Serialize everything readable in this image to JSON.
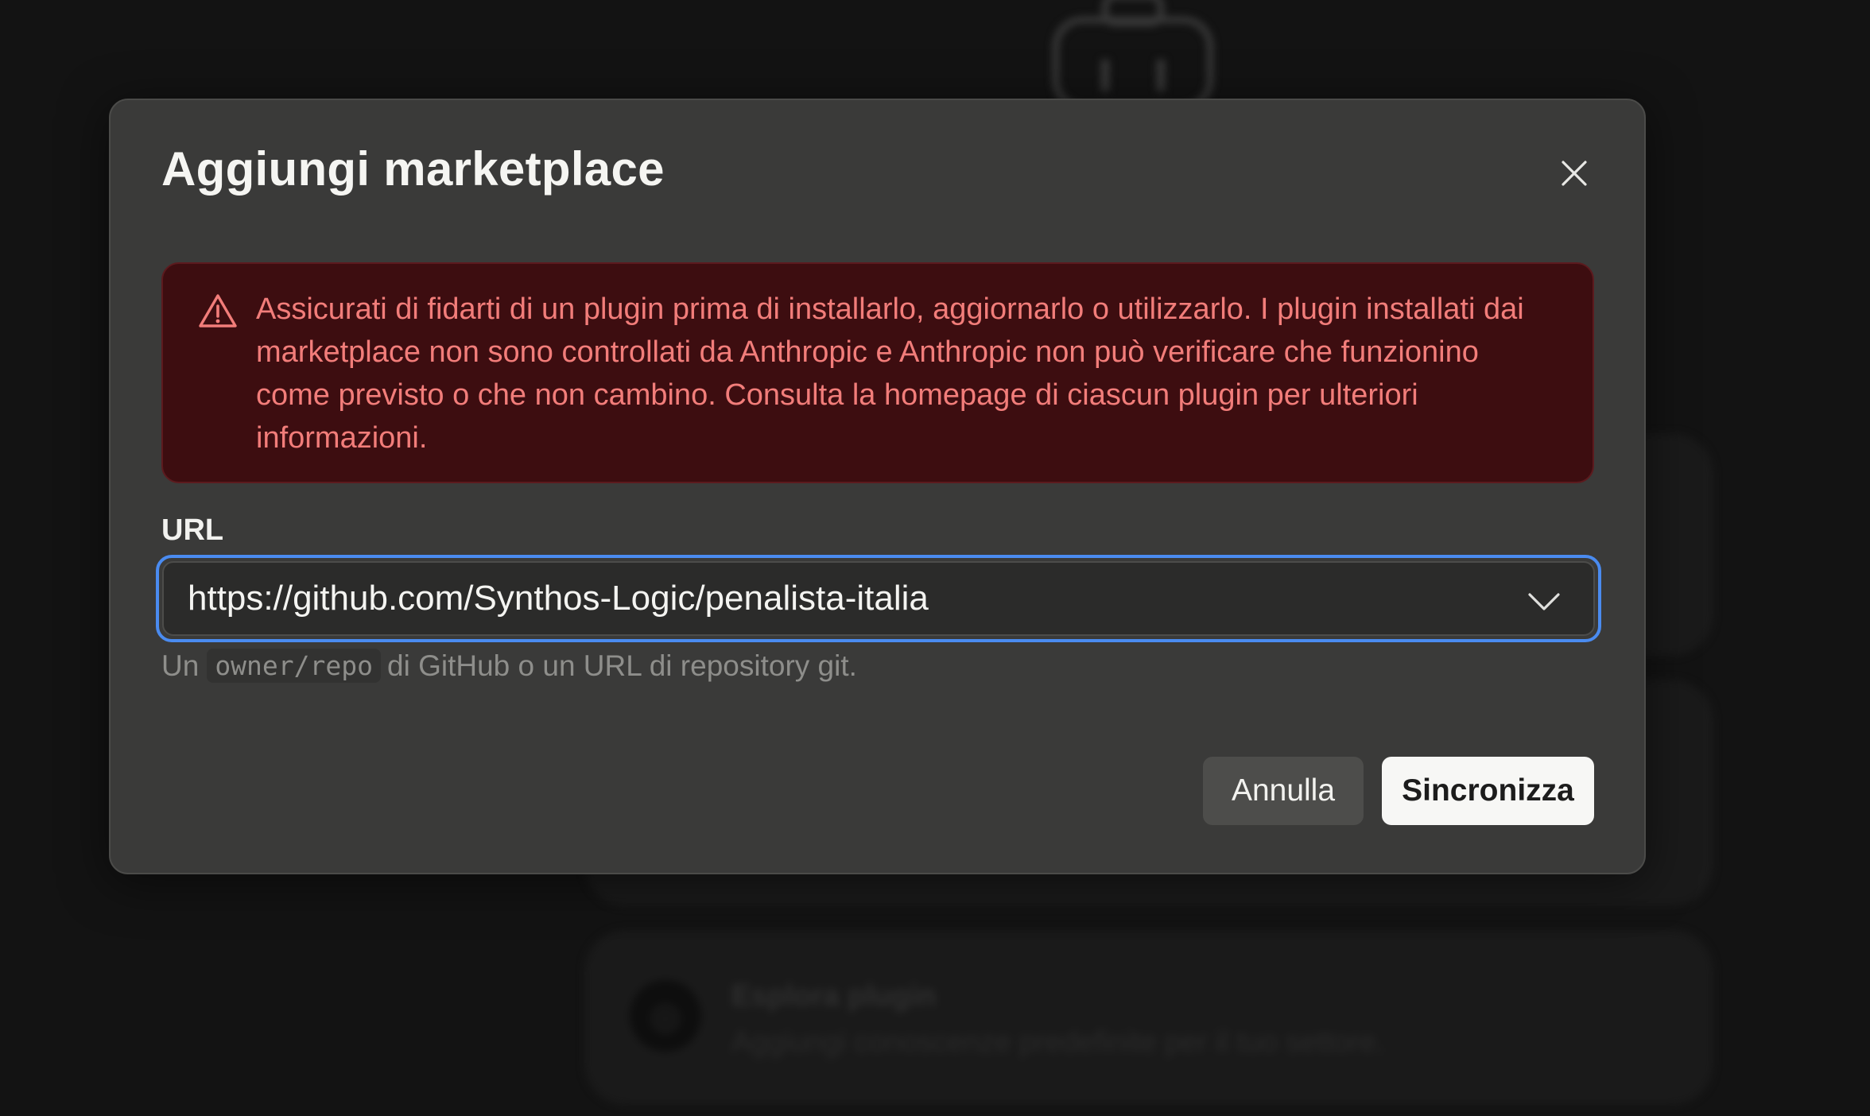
{
  "background": {
    "cards": [
      {
        "title": "",
        "subtitle": ""
      },
      {
        "title": "",
        "subtitle": ""
      },
      {
        "title": "Esplora plugin",
        "subtitle": "Aggiungi conoscenze predefinite per il tuo settore."
      }
    ]
  },
  "dialog": {
    "title": "Aggiungi marketplace",
    "warning": "Assicurati di fidarti di un plugin prima di installarlo, aggiornarlo o utilizzarlo. I plugin installati dai marketplace non sono controllati da Anthropic e Anthropic non può verificare che funzionino come previsto o che non cambino. Consulta la homepage di ciascun plugin per ulteriori informazioni.",
    "url_label": "URL",
    "url_value": "https://github.com/Synthos-Logic/penalista-italia",
    "helper_prefix": "Un",
    "helper_code": "owner/repo",
    "helper_suffix": "di GitHub o un URL di repository git.",
    "cancel_label": "Annulla",
    "submit_label": "Sincronizza"
  },
  "colors": {
    "accent_focus": "#4a8bf0",
    "warning_text": "#f27d7a",
    "warning_bg": "#3d0d10",
    "modal_bg": "#3a3a39"
  }
}
